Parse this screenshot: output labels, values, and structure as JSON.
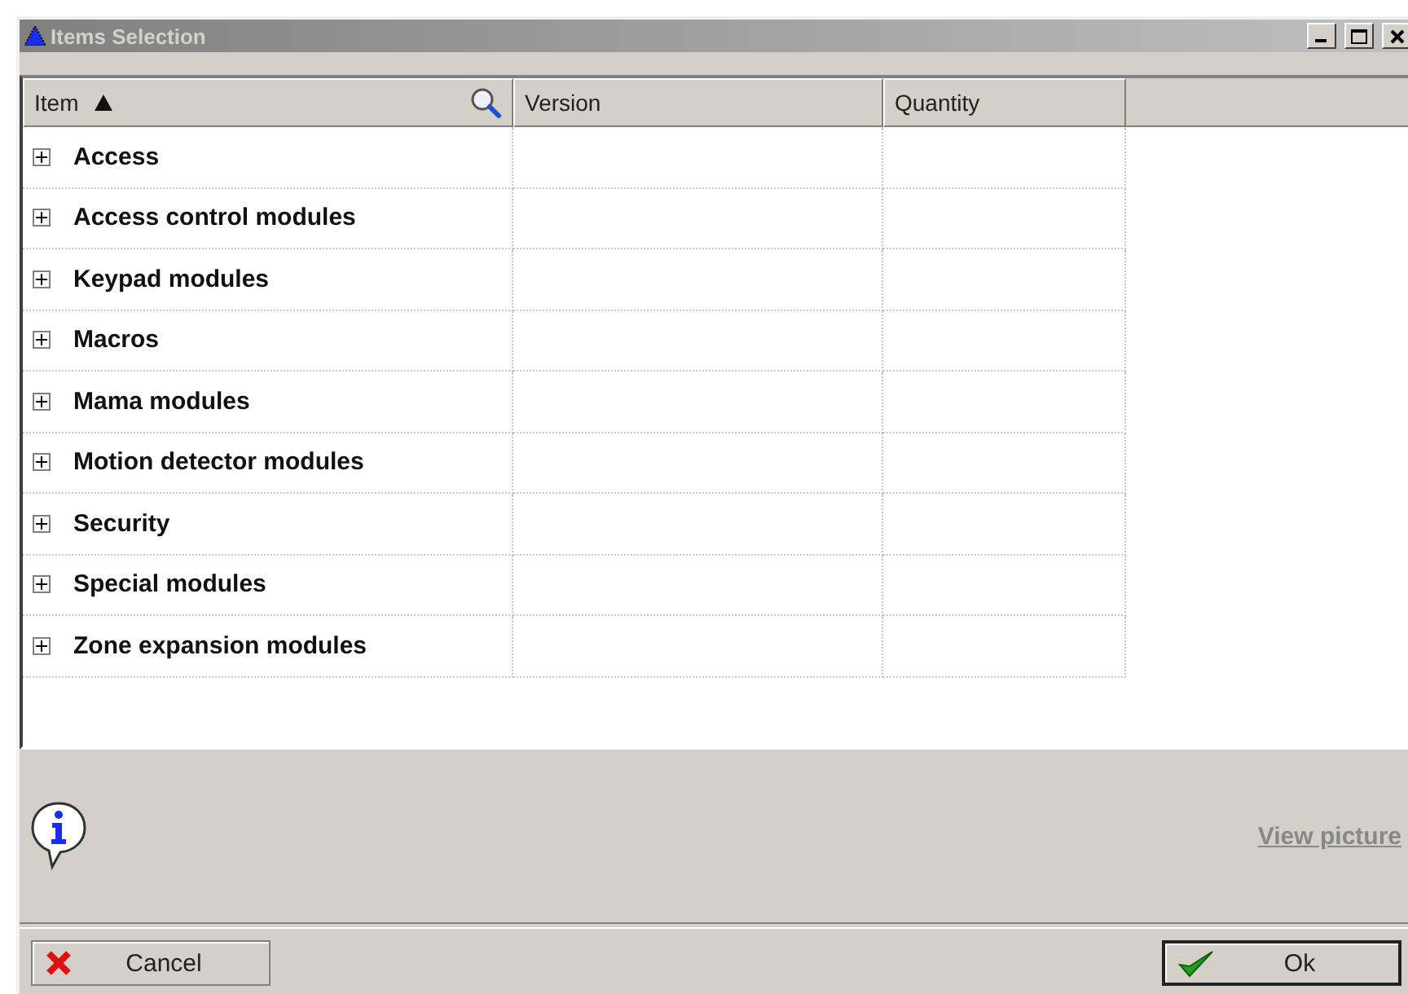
{
  "window": {
    "title": "Items Selection"
  },
  "table": {
    "columns": [
      {
        "label": "Item",
        "sorted": true,
        "searchable": true
      },
      {
        "label": "Version",
        "sorted": false,
        "searchable": false
      },
      {
        "label": "Quantity",
        "sorted": false,
        "searchable": false
      }
    ],
    "rows": [
      {
        "item": "Access",
        "expanded": false
      },
      {
        "item": "Access control modules",
        "expanded": false
      },
      {
        "item": "Keypad modules",
        "expanded": false
      },
      {
        "item": "Macros",
        "expanded": false
      },
      {
        "item": "Mama modules",
        "expanded": false
      },
      {
        "item": "Motion detector modules",
        "expanded": false
      },
      {
        "item": "Security",
        "expanded": false
      },
      {
        "item": "Special modules",
        "expanded": false
      },
      {
        "item": "Zone expansion modules",
        "expanded": false
      }
    ]
  },
  "info_panel": {
    "link": "View picture"
  },
  "buttons": [
    {
      "kind": "cancel",
      "label": "Cancel"
    },
    {
      "kind": "ok",
      "label": "Ok"
    }
  ]
}
